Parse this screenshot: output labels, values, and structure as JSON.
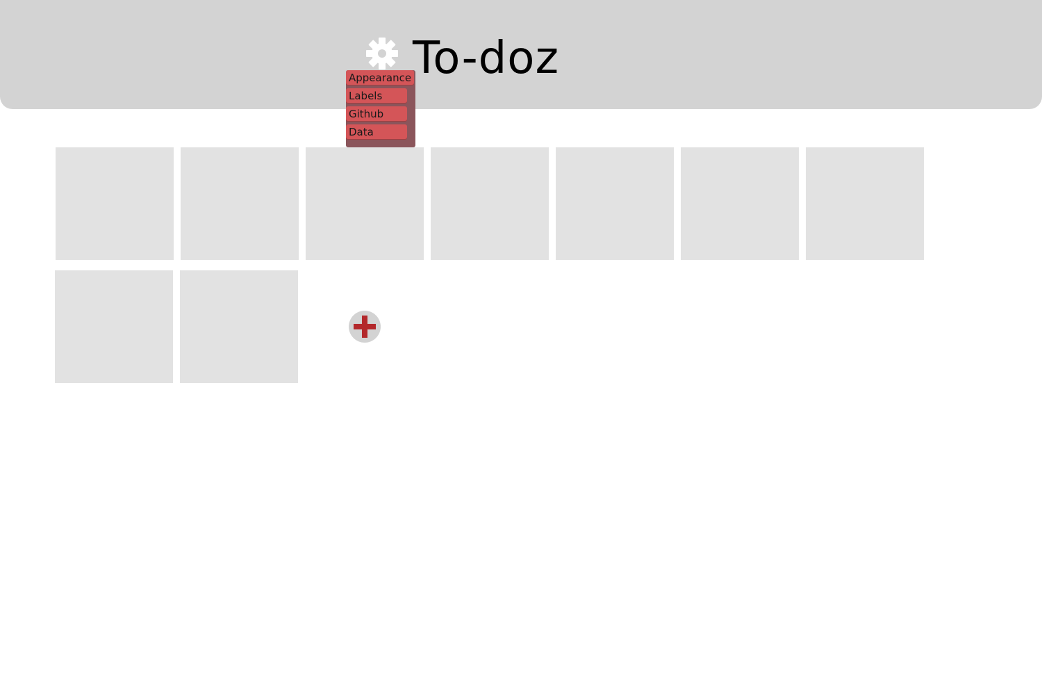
{
  "header": {
    "title": "To-doz",
    "settings_icon": "gear-icon"
  },
  "settings_menu": {
    "items": [
      {
        "label": "Appearance"
      },
      {
        "label": "Labels"
      },
      {
        "label": "Github"
      },
      {
        "label": "Data"
      }
    ]
  },
  "grid": {
    "item_count": 9
  },
  "add_button": {
    "icon": "plus-icon",
    "color": "#b3282b"
  },
  "colors": {
    "header_bg": "#d3d3d3",
    "menu_bg": "#8b555b",
    "menu_item_bg": "#d45558",
    "cell_bg": "#e2e2e2",
    "accent": "#b3282b"
  }
}
